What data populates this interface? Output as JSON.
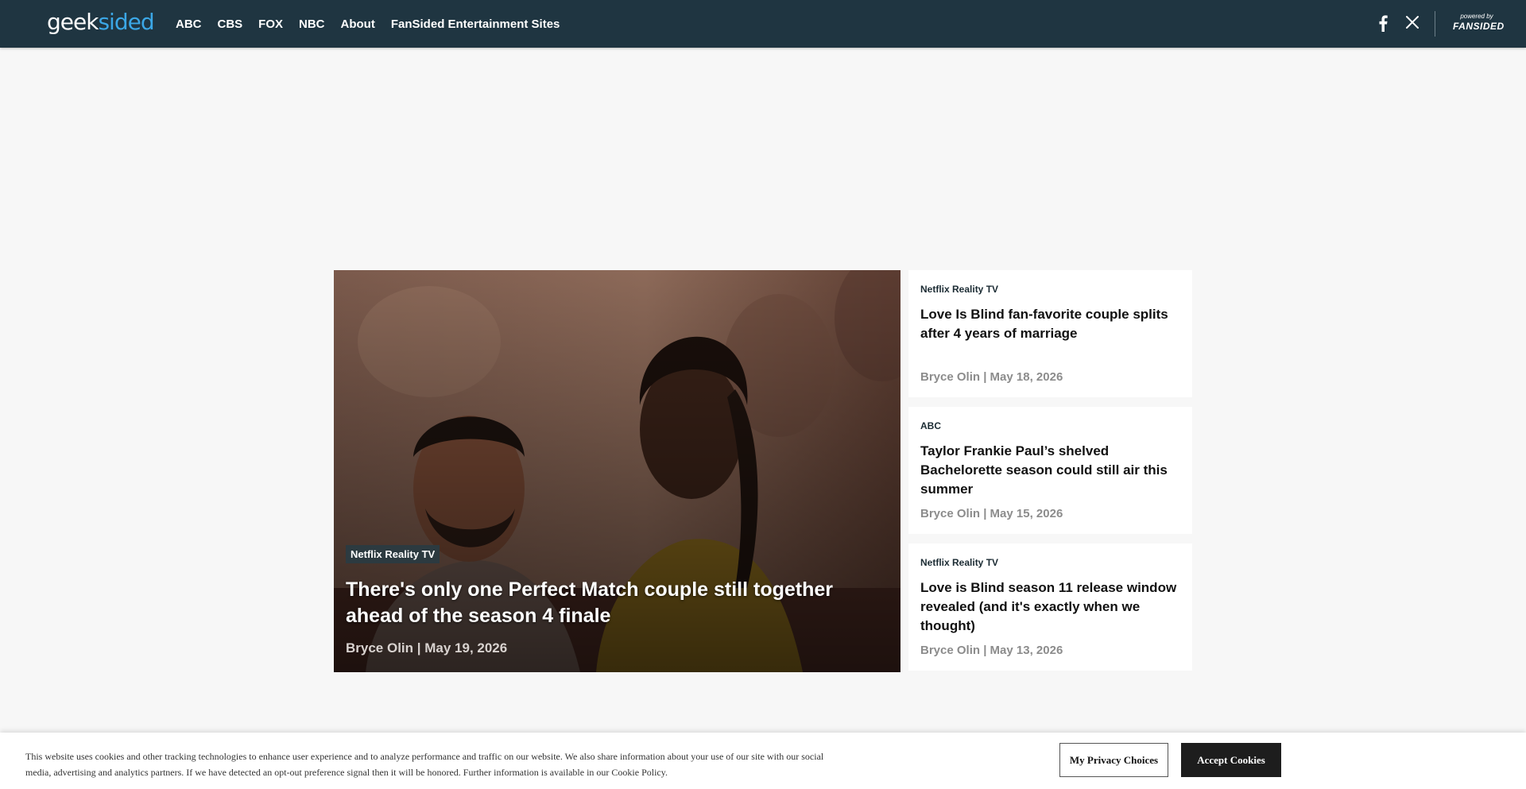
{
  "header": {
    "logo_part1": "geek",
    "logo_part2": "sided",
    "nav": [
      "ABC",
      "CBS",
      "FOX",
      "NBC",
      "About",
      "FanSided Entertainment Sites"
    ],
    "powered_by": "powered by",
    "network": "FANSIDED",
    "social_icons": [
      "facebook-icon",
      "x-icon"
    ],
    "colors": {
      "bar": "#1f3541",
      "logo_accent": "#3ba7e6"
    }
  },
  "hero": {
    "category": "Netflix Reality TV",
    "title": "There's only one Perfect Match couple still together ahead of the season 4 finale",
    "byline": "Bryce Olin | May 19, 2026"
  },
  "cards": [
    {
      "category": "Netflix Reality TV",
      "title": "Love Is Blind fan-favorite couple splits after 4 years of marriage",
      "byline": "Bryce Olin | May 18, 2026"
    },
    {
      "category": "ABC",
      "title": "Taylor Frankie Paul’s shelved Bachelorette season could still air this summer",
      "byline": "Bryce Olin | May 15, 2026"
    },
    {
      "category": "Netflix Reality TV",
      "title": "Love is Blind season 11 release window revealed (and it's exactly when we thought)",
      "byline": "Bryce Olin | May 13, 2026"
    }
  ],
  "cookie": {
    "text": "This website uses cookies and other tracking technologies to enhance user experience and to analyze performance and traffic on our website. We also share information about your use of our site with our social media, advertising and analytics partners. If we have detected an opt-out preference signal then it will be honored. Further information is available in our Cookie Policy.",
    "privacy_button": "My Privacy Choices",
    "accept_button": "Accept Cookies"
  }
}
